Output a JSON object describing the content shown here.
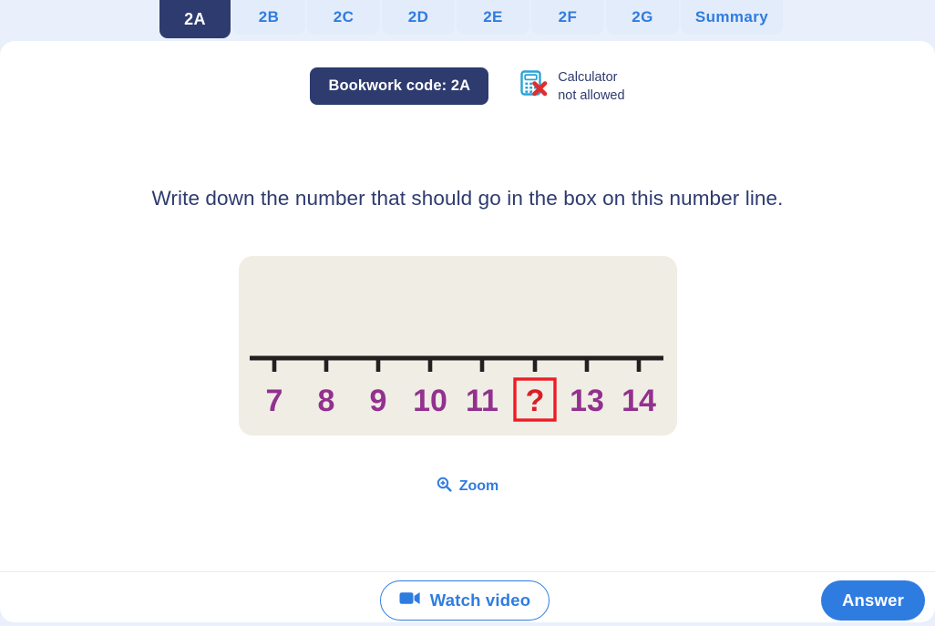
{
  "tabs": [
    {
      "label": "2A",
      "active": true
    },
    {
      "label": "2B",
      "active": false
    },
    {
      "label": "2C",
      "active": false
    },
    {
      "label": "2D",
      "active": false
    },
    {
      "label": "2E",
      "active": false
    },
    {
      "label": "2F",
      "active": false
    },
    {
      "label": "2G",
      "active": false
    },
    {
      "label": "Summary",
      "active": false
    }
  ],
  "header": {
    "bookwork_code": "Bookwork code: 2A",
    "calculator_line1": "Calculator",
    "calculator_line2": "not allowed",
    "calculator_icon": "calculator-not-allowed-icon"
  },
  "question": {
    "text": "Write down the number that should go in the box on this number line."
  },
  "number_line": {
    "labels": [
      "7",
      "8",
      "9",
      "10",
      "11",
      "?",
      "13",
      "14"
    ],
    "missing_index": 5,
    "missing_label": "?",
    "tick_count": 8,
    "panel_color": "#f0ede5",
    "number_color": "#93318f",
    "missing_color": "#d81f26",
    "box_border_color": "#ed1c24",
    "line_color": "#231f20"
  },
  "zoom": {
    "label": "Zoom",
    "icon": "magnifier-plus-icon"
  },
  "footer": {
    "watch_video_label": "Watch video",
    "watch_video_icon": "video-camera-icon",
    "answer_label": "Answer"
  },
  "colors": {
    "page_background": "#e9f0fb",
    "card_background": "#ffffff",
    "navy": "#2e3b6e",
    "blue": "#2f7ce0",
    "tab_inactive_bg": "#e3ecfa"
  }
}
